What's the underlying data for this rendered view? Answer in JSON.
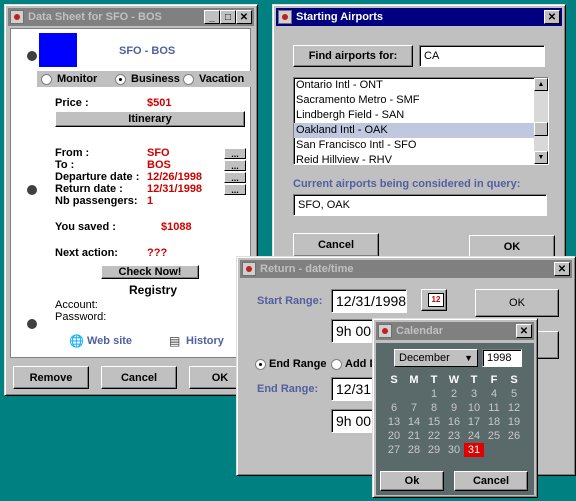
{
  "datasheet": {
    "title": "Data Sheet for SFO - BOS",
    "route": "SFO - BOS",
    "options": [
      "Monitor",
      "Business",
      "Vacation"
    ],
    "selected_option": "Business",
    "price_label": "Price :",
    "price_value": "$501",
    "itinerary_button": "Itinerary",
    "from_label": "From :",
    "from_value": "SFO",
    "to_label": "To :",
    "to_value": "BOS",
    "departure_label": "Departure date :",
    "departure_value": "12/26/1998",
    "return_label": "Return date :",
    "return_value": "12/31/1998",
    "passengers_label": "Nb passengers:",
    "passengers_value": "1",
    "saved_label": "You saved :",
    "saved_value": "$1088",
    "next_action_label": "Next action:",
    "next_action_value": "???",
    "check_button": "Check Now!",
    "registry_title": "Registry",
    "account_label": "Account:",
    "password_label": "Password:",
    "website_link": "Web site",
    "history_link": "History",
    "dots": "...",
    "buttons": {
      "remove": "Remove",
      "cancel": "Cancel",
      "ok": "OK"
    }
  },
  "airports": {
    "title": "Starting Airports",
    "find_button": "Find airports for:",
    "search_value": "CA",
    "list": [
      "Ontario Intl - ONT",
      "Sacramento Metro - SMF",
      "Lindbergh Field - SAN",
      "Oakland Intl - OAK",
      "San Francisco Intl - SFO",
      "Reid Hillview - RHV"
    ],
    "selected_index": 3,
    "current_label": "Current airports being considered in query:",
    "current_value": "SFO, OAK",
    "buttons": {
      "cancel": "Cancel",
      "ok": "OK"
    }
  },
  "return_dialog": {
    "title": "Return - date/time",
    "start_label": "Start Range:",
    "start_date": "12/31/1998",
    "start_time": "9h 00",
    "end_radio_label": "End Range",
    "add_label": "Add D",
    "end_label": "End Range:",
    "end_date": "12/31.",
    "end_time": "9h 00",
    "ok_button": "OK",
    "calendar_icon_text": "12"
  },
  "calendar": {
    "title": "Calendar",
    "month": "December",
    "year": "1998",
    "weekdays": [
      "S",
      "M",
      "T",
      "W",
      "T",
      "F",
      "S"
    ],
    "days": [
      [
        "",
        "",
        "1",
        "2",
        "3",
        "4",
        "5"
      ],
      [
        "6",
        "7",
        "8",
        "9",
        "10",
        "11",
        "12"
      ],
      [
        "13",
        "14",
        "15",
        "16",
        "17",
        "18",
        "19"
      ],
      [
        "20",
        "21",
        "22",
        "23",
        "24",
        "25",
        "26"
      ],
      [
        "27",
        "28",
        "29",
        "30",
        "31",
        "",
        ""
      ]
    ],
    "selected_day": "31",
    "ok_button": "Ok",
    "cancel_button": "Cancel"
  },
  "colors": {
    "title_active": "#000080",
    "price_red": "#d00000",
    "label_blue": "#5060a0",
    "desktop": "#008080"
  }
}
